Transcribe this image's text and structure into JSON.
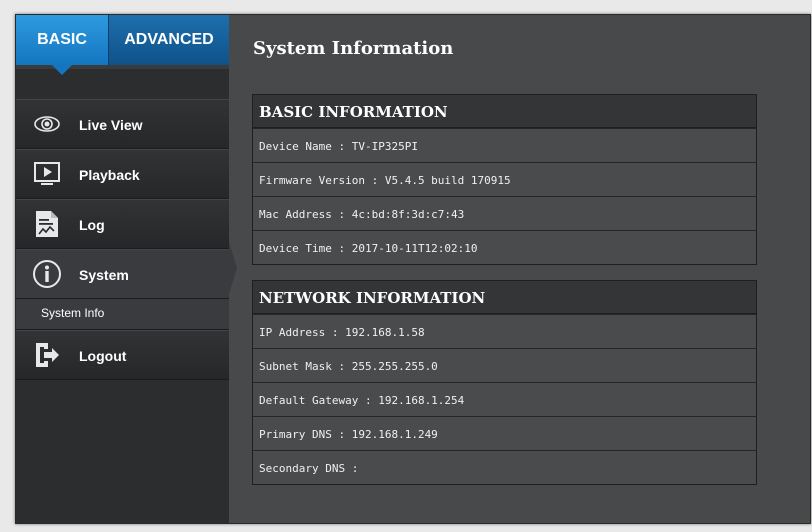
{
  "tabs": {
    "basic": "BASIC",
    "advanced": "ADVANCED"
  },
  "sidebar": {
    "items": [
      {
        "label": "Live View",
        "icon": "eye-icon"
      },
      {
        "label": "Playback",
        "icon": "play-icon"
      },
      {
        "label": "Log",
        "icon": "log-icon"
      },
      {
        "label": "System",
        "icon": "info-icon"
      },
      {
        "label": "Logout",
        "icon": "logout-icon"
      }
    ],
    "submenu": {
      "label": "System Info"
    }
  },
  "main": {
    "title": "System Information",
    "basic": {
      "header": "BASIC INFORMATION",
      "rows": [
        "Device Name : TV-IP325PI",
        "Firmware Version : V5.4.5 build 170915",
        "Mac Address : 4c:bd:8f:3d:c7:43",
        "Device Time : 2017-10-11T12:02:10"
      ]
    },
    "network": {
      "header": "NETWORK INFORMATION",
      "rows": [
        "IP Address : 192.168.1.58",
        "Subnet Mask : 255.255.255.0",
        "Default Gateway : 192.168.1.254",
        "Primary DNS : 192.168.1.249",
        "Secondary DNS :"
      ]
    }
  },
  "colors": {
    "accent": "#1476c0",
    "panel": "#48494b",
    "sidebar": "#2c2d2f"
  }
}
